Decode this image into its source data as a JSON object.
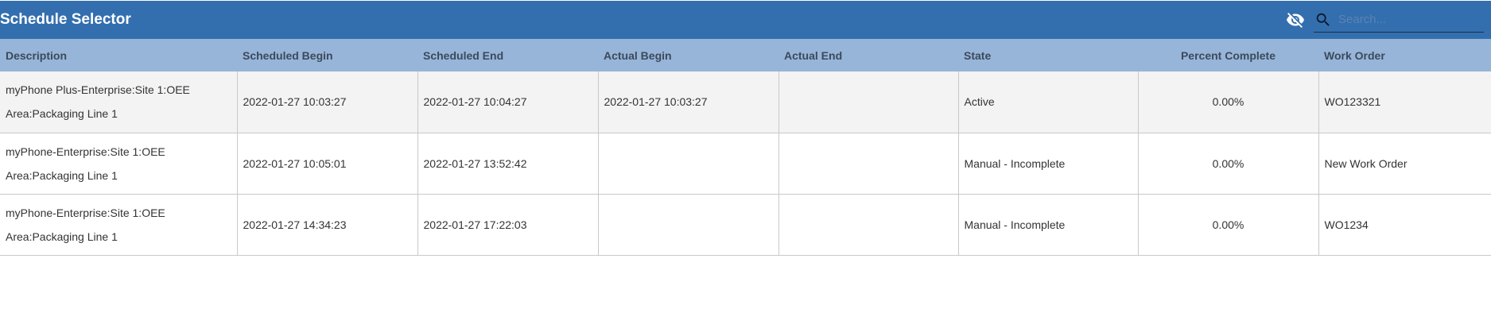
{
  "header": {
    "title": "Schedule Selector",
    "hide_icon": "eye-off-icon",
    "search_icon": "search-icon",
    "search_placeholder": "Search..."
  },
  "colors": {
    "header_bg": "#336faf",
    "table_header_bg": "#97b5d8",
    "selected_row_bg": "#f3f3f3"
  },
  "table": {
    "columns": [
      "Description",
      "Scheduled Begin",
      "Scheduled End",
      "Actual Begin",
      "Actual End",
      "State",
      "Percent Complete",
      "Work Order"
    ],
    "rows": [
      {
        "description_line1": "myPhone Plus-Enterprise:Site 1:OEE",
        "description_line2": "Area:Packaging Line 1",
        "scheduled_begin": "2022-01-27 10:03:27",
        "scheduled_end": "2022-01-27 10:04:27",
        "actual_begin": "2022-01-27 10:03:27",
        "actual_end": "",
        "state": "Active",
        "percent_complete": "0.00%",
        "work_order": "WO123321"
      },
      {
        "description_line1": "myPhone-Enterprise:Site 1:OEE",
        "description_line2": "Area:Packaging Line 1",
        "scheduled_begin": "2022-01-27 10:05:01",
        "scheduled_end": "2022-01-27 13:52:42",
        "actual_begin": "",
        "actual_end": "",
        "state": "Manual - Incomplete",
        "percent_complete": "0.00%",
        "work_order": "New Work Order"
      },
      {
        "description_line1": "myPhone-Enterprise:Site 1:OEE",
        "description_line2": "Area:Packaging Line 1",
        "scheduled_begin": "2022-01-27 14:34:23",
        "scheduled_end": "2022-01-27 17:22:03",
        "actual_begin": "",
        "actual_end": "",
        "state": "Manual - Incomplete",
        "percent_complete": "0.00%",
        "work_order": "WO1234"
      }
    ]
  }
}
